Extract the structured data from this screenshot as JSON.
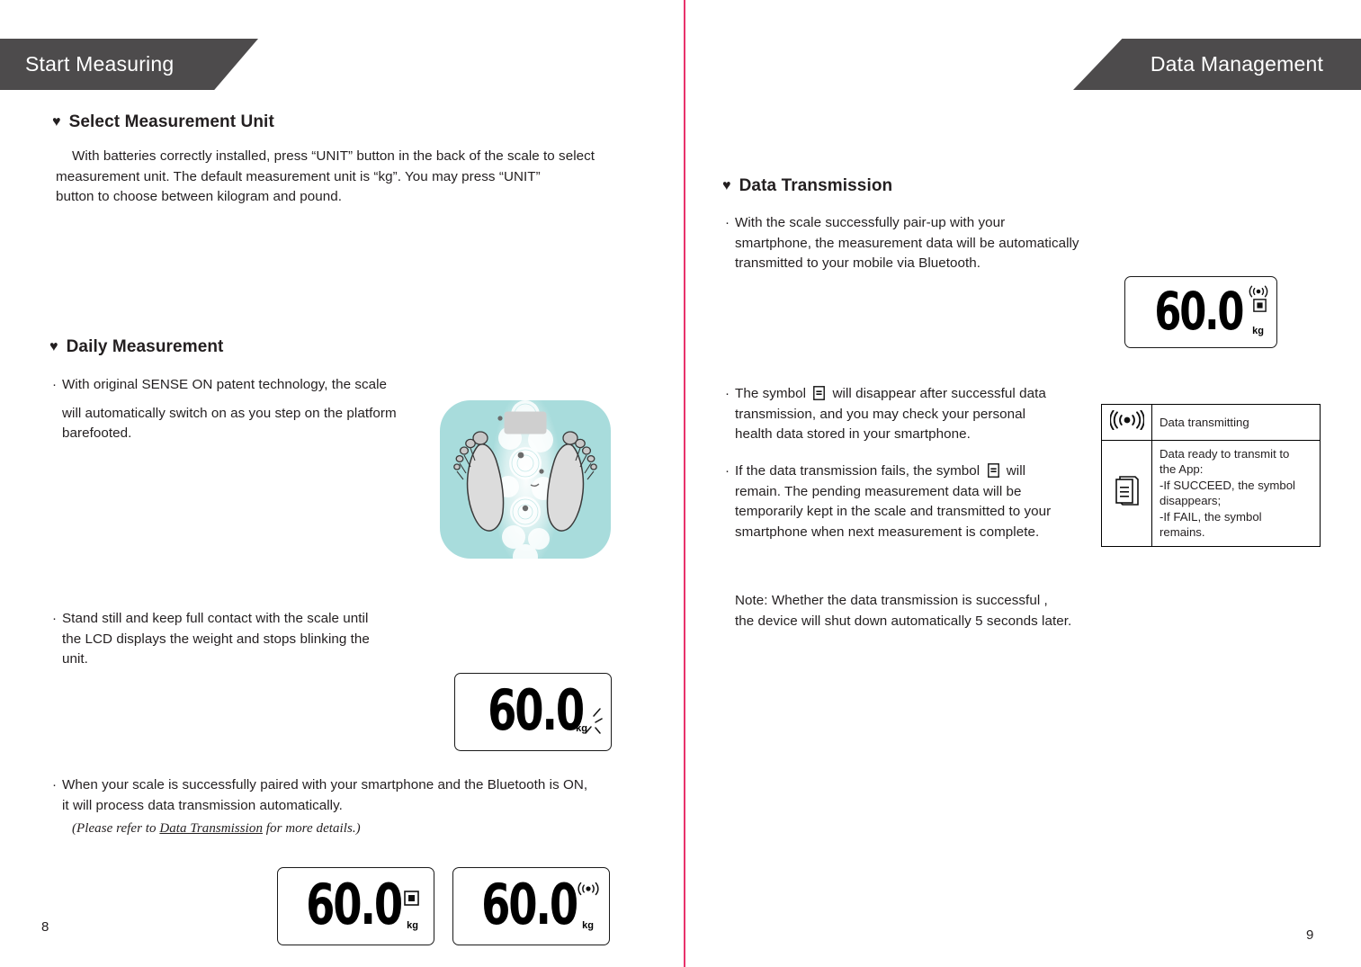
{
  "left_page": {
    "banner": {
      "title": "Start Measuring"
    },
    "page_number": "8",
    "section1": {
      "heart_icon": "heart-icon",
      "heading": "Select Measurement Unit",
      "paragraph_lines": [
        "With batteries correctly installed, press “UNIT” button in the back of the scale to select",
        "measurement unit. The default measurement unit is “kg”. You may press “UNIT”",
        "button to choose between kilogram and pound."
      ]
    },
    "section2": {
      "heart_icon": "heart-icon",
      "heading": "Daily Measurement",
      "bullet1": {
        "marker": "·",
        "lines": [
          "With original SENSE ON patent technology, the scale",
          "will automatically switch on as you step on the platform",
          "barefooted."
        ]
      },
      "bullet2": {
        "marker": "·",
        "lines": [
          "Stand still and keep full contact with the scale until",
          "the LCD displays the weight and stops blinking the",
          "unit."
        ]
      },
      "bullet3": {
        "marker": "·",
        "lines": [
          "When your scale is successfully paired with your smartphone and the Bluetooth is ON,",
          "it will process data transmission automatically."
        ]
      },
      "note_italic": {
        "prefix": "(Please refer to ",
        "link": "Data Transmission",
        "suffix": " for more details.)"
      },
      "illustration": "scale-with-feet-illustration"
    },
    "lcd_blinking": {
      "value": "60.0",
      "unit": "kg",
      "blink_marks": true,
      "icons": []
    },
    "lcd_pending": {
      "value": "60.0",
      "unit": "kg",
      "icons": [
        "document-symbol"
      ]
    },
    "lcd_transmitting": {
      "value": "60.0",
      "unit": "kg",
      "icons": [
        "transmitting-wave-icon"
      ]
    }
  },
  "right_page": {
    "banner": {
      "title": "Data Management"
    },
    "page_number": "9",
    "section": {
      "heart_icon": "heart-icon",
      "heading": "Data Transmission",
      "bullet1": {
        "marker": "·",
        "lines": [
          "With the scale successfully pair-up with your",
          "smartphone, the measurement data will be automatically",
          "transmitted to your mobile via Bluetooth."
        ]
      },
      "bullet2": {
        "marker": "·",
        "line1_before_symbol": "The symbol ",
        "line1_after_symbol": " will disappear after successful data",
        "lines_rest": [
          "transmission, and you may check your personal",
          "health data stored in your smartphone."
        ]
      },
      "bullet3": {
        "marker": "·",
        "line1_before_symbol": "If the data transmission fails, the symbol ",
        "line1_after_symbol": " will",
        "lines_rest": [
          "remain. The pending measurement data will be",
          "temporarily kept in the scale and transmitted to your",
          "smartphone when next measurement is complete."
        ]
      },
      "note_lines": [
        "Note: Whether the data transmission is successful ,",
        "the device will shut down automatically  5 seconds later."
      ]
    },
    "lcd_display": {
      "value": "60.0",
      "unit": "kg",
      "icons": [
        "transmitting-wave-icon",
        "document-symbol"
      ]
    },
    "symbol_table": {
      "rows": [
        {
          "icon": "transmitting-wave-icon",
          "lines": [
            "Data transmitting"
          ]
        },
        {
          "icon": "document-symbol",
          "lines": [
            "Data ready to transmit to",
            "the App:",
            "-If SUCCEED, the symbol",
            "disappears;",
            "-If FAIL, the symbol",
            "remains."
          ]
        }
      ]
    }
  },
  "colors": {
    "banner_bg": "#4d4b4c",
    "banner_text": "#ffffff",
    "body_text": "#231f20",
    "spine_divider": "#e8336b",
    "scale_platform": "#a8dcdc",
    "foot_fill": "#dcdcdc"
  }
}
